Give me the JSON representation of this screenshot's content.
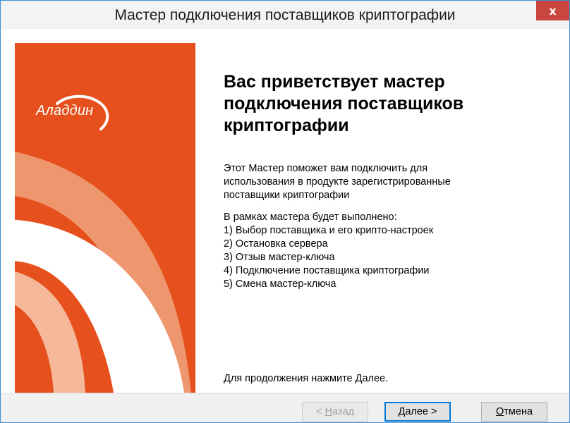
{
  "window": {
    "title": "Мастер подключения поставщиков криптографии",
    "close_label": "x"
  },
  "brand": {
    "logo_text": "Аладдин",
    "banner_color": "#e5501c"
  },
  "main": {
    "heading": "Вас приветствует мастер\nподключения поставщиков\nкриптографии",
    "intro": "Этот Мастер поможет вам подключить для\nиспользования в продукте зарегистрированные\nпоставщики криптографии",
    "steps_title": "В рамках мастера будет выполнено:",
    "steps": [
      "1) Выбор поставщика и его крипто-настроек",
      "2) Остановка сервера",
      "3) Отзыв мастер-ключа",
      "4) Подключение поставщика криптографии",
      "5) Смена мастер-ключа"
    ],
    "footer": "Для продолжения нажмите Далее."
  },
  "buttons": {
    "back": {
      "prefix": "< ",
      "mnemonic": "Н",
      "rest": "азад"
    },
    "next": {
      "mnemonic": "Д",
      "rest": "алее >"
    },
    "cancel": {
      "mnemonic": "О",
      "rest": "тмена"
    }
  }
}
